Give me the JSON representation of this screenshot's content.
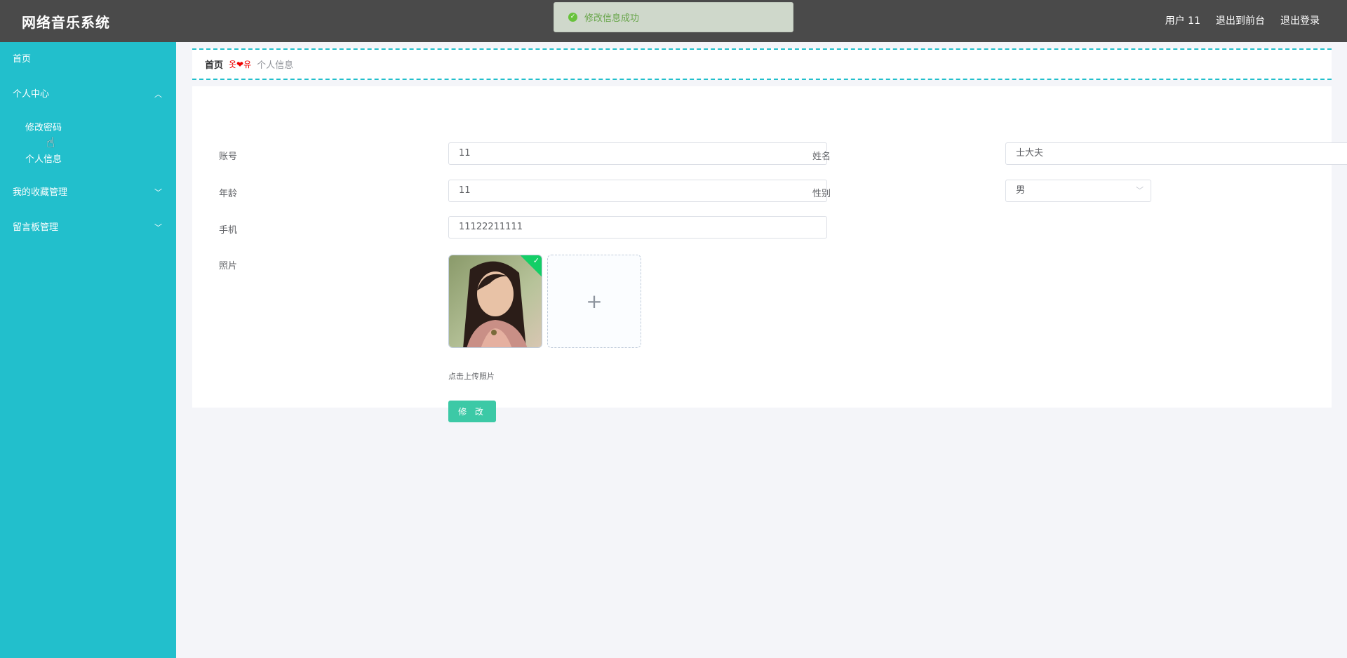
{
  "header": {
    "app_title": "网络音乐系统",
    "user_label": "用户 11",
    "to_front_label": "退出到前台",
    "logout_label": "退出登录"
  },
  "toast": {
    "message": "修改信息成功",
    "icon": "success-check-icon"
  },
  "sidebar": {
    "items": [
      {
        "label": "首页"
      },
      {
        "label": "个人中心",
        "expanded": true,
        "children": [
          {
            "label": "修改密码"
          },
          {
            "label": "个人信息"
          }
        ]
      },
      {
        "label": "我的收藏管理",
        "expanded": false
      },
      {
        "label": "留言板管理",
        "expanded": false
      }
    ]
  },
  "breadcrumb": {
    "home": "首页",
    "separator": "옷❤유",
    "current": "个人信息"
  },
  "form": {
    "account": {
      "label": "账号",
      "value": "11"
    },
    "name": {
      "label": "姓名",
      "value": "士大夫"
    },
    "age": {
      "label": "年龄",
      "value": "11"
    },
    "gender": {
      "label": "性别",
      "value": "男"
    },
    "phone": {
      "label": "手机",
      "value": "11122211111"
    },
    "photo": {
      "label": "照片",
      "upload_tip": "点击上传照片"
    },
    "submit_label": "修 改"
  },
  "colors": {
    "topbar": "#4a4a4a",
    "sidebar": "#22bfcc",
    "submit": "#3cc9a6",
    "breadcrumb_border": "#22bfcc"
  }
}
